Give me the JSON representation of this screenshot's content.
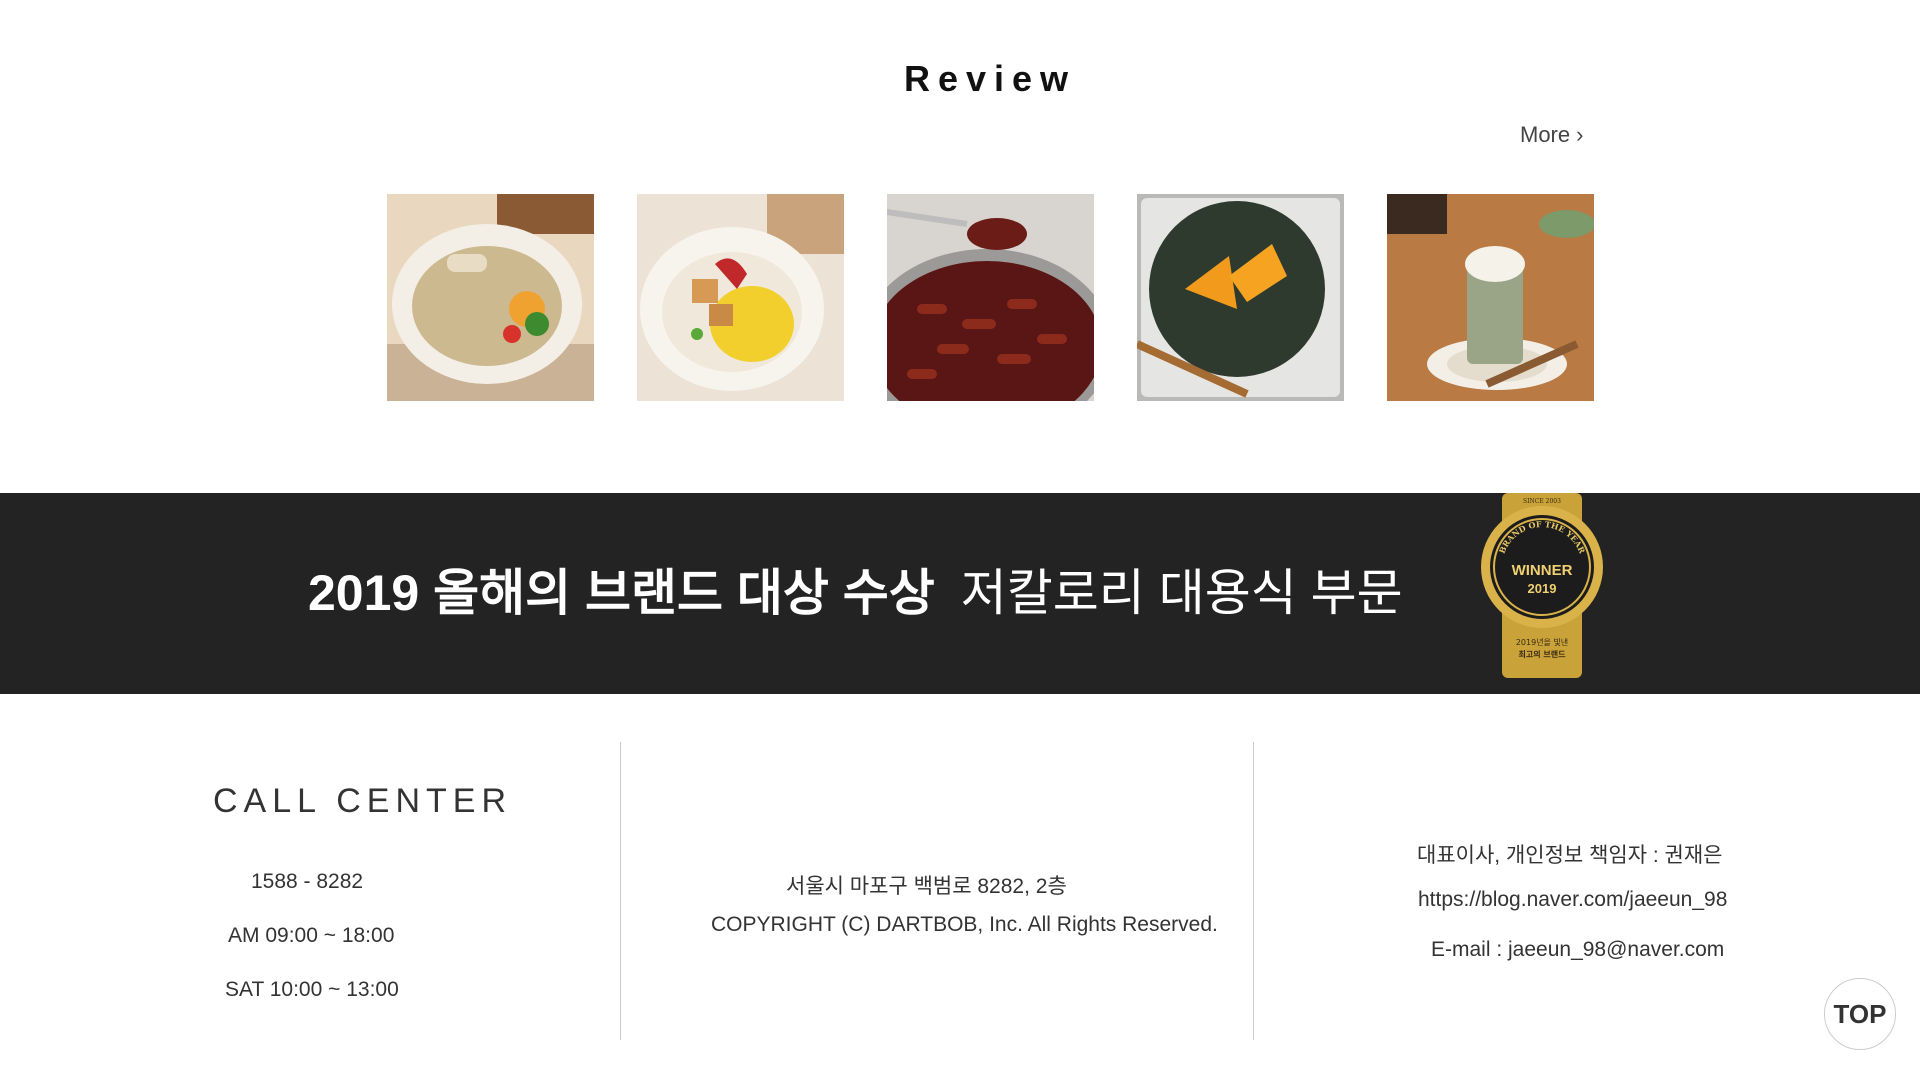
{
  "review": {
    "title": "Review",
    "more_label": "More",
    "thumbnails": [
      {
        "icon": "food-bowl-rice-vegetables"
      },
      {
        "icon": "food-bowl-tofu-egg"
      },
      {
        "icon": "food-pan-tteokbokki"
      },
      {
        "icon": "food-plate-pumpkin"
      },
      {
        "icon": "food-glass-matcha-latte"
      }
    ]
  },
  "banner": {
    "headline_strong": "2019 올해의 브랜드 대상 수상",
    "headline_light": "저칼로리 대용식 부문",
    "badge_since": "SINCE 2003",
    "badge_arc": "BRAND OF THE YEAR",
    "badge_winner": "WINNER",
    "badge_year": "2019",
    "badge_note1": "2019년을 빛낸",
    "badge_note2": "최고의 브랜드",
    "bg_color": "#232323",
    "gold_color": "#c9a23a"
  },
  "footer": {
    "call_center": {
      "title": "CALL CENTER",
      "phone": "1588 - 8282",
      "weekday_hours": "AM 09:00 ~ 18:00",
      "sat_hours": "SAT 10:00 ~ 13:00"
    },
    "address": "서울시 마포구 백범로 8282, 2층",
    "copyright": "COPYRIGHT (C) DARTBOB, Inc. All Rights Reserved.",
    "ceo": "대표이사, 개인정보 책임자 : 권재은",
    "blog": "https://blog.naver.com/jaeeun_98",
    "email": "E-mail : jaeeun_98@naver.com"
  },
  "top_button": {
    "label": "TOP"
  }
}
